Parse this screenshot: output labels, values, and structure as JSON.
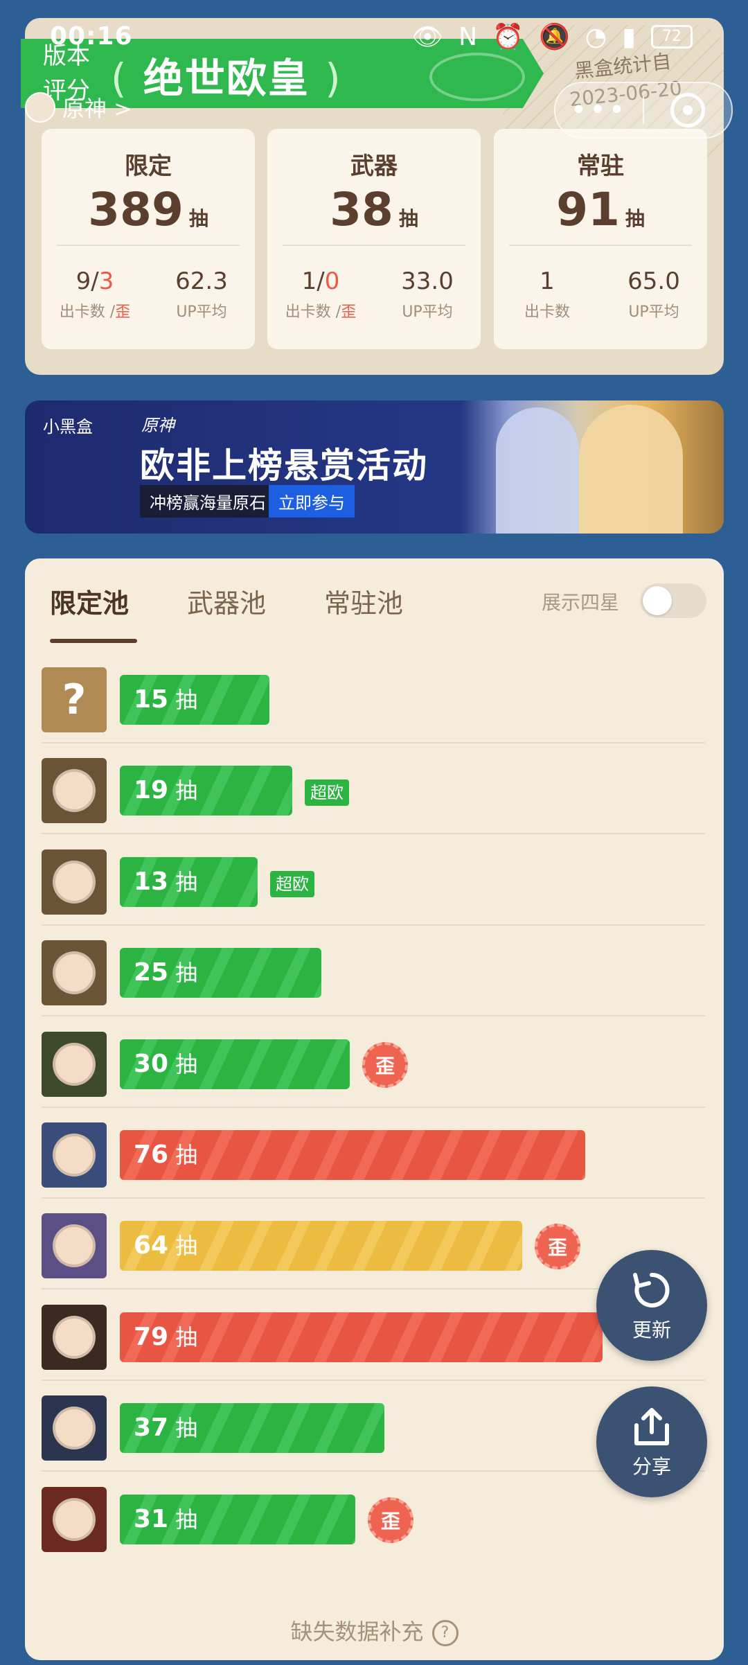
{
  "status_bar": {
    "time": "00:16",
    "battery": "72"
  },
  "header": {
    "banner_tag_line1": "版本",
    "banner_tag_line2": "评分",
    "banner_title": "绝世欧皇",
    "laurel_left": "(",
    "laurel_right": ")",
    "game_name": "原神 >",
    "stamp_line1": "黑盒统计自",
    "stamp_line2": "2023-06-20",
    "capsule_dots": "•••"
  },
  "stats": [
    {
      "title": "限定",
      "count": "389",
      "unit": "抽",
      "cards": "9/",
      "cards_off": "3",
      "avg": "62.3",
      "cards_label": "出卡数 /",
      "cards_label_off": "歪",
      "avg_label": "UP平均"
    },
    {
      "title": "武器",
      "count": "38",
      "unit": "抽",
      "cards": "1/",
      "cards_off": "0",
      "avg": "33.0",
      "cards_label": "出卡数 /",
      "cards_label_off": "歪",
      "avg_label": "UP平均"
    },
    {
      "title": "常驻",
      "count": "91",
      "unit": "抽",
      "cards": "1",
      "cards_off": "",
      "avg": "65.0",
      "cards_label": "出卡数",
      "cards_label_off": "",
      "avg_label": "UP平均"
    }
  ],
  "ad": {
    "logo": "小黑盒",
    "logo2": "原神",
    "title": "欧非上榜悬赏活动",
    "subtitle": "冲榜赢海量原石",
    "button": "立即参与"
  },
  "tabs": [
    "限定池",
    "武器池",
    "常驻池"
  ],
  "toggle_label": "展示四星",
  "rows": [
    {
      "count": "15",
      "unit": "抽",
      "color": "green",
      "fill": 0.26,
      "tag": "",
      "wai": "",
      "avatar": "#b08a55",
      "mystery": "?"
    },
    {
      "count": "19",
      "unit": "抽",
      "color": "green",
      "fill": 0.3,
      "tag": "超欧",
      "wai": "",
      "avatar": "#6b5335",
      "mystery": ""
    },
    {
      "count": "13",
      "unit": "抽",
      "color": "green",
      "fill": 0.24,
      "tag": "超欧",
      "wai": "",
      "avatar": "#6b5335",
      "mystery": ""
    },
    {
      "count": "25",
      "unit": "抽",
      "color": "green",
      "fill": 0.35,
      "tag": "",
      "wai": "",
      "avatar": "#6b5335",
      "mystery": ""
    },
    {
      "count": "30",
      "unit": "抽",
      "color": "green",
      "fill": 0.4,
      "tag": "",
      "wai": "歪",
      "avatar": "#3d4a2c",
      "mystery": ""
    },
    {
      "count": "76",
      "unit": "抽",
      "color": "red",
      "fill": 0.81,
      "tag": "",
      "wai": "",
      "avatar": "#3a4d7a",
      "mystery": ""
    },
    {
      "count": "64",
      "unit": "抽",
      "color": "yellow",
      "fill": 0.7,
      "tag": "",
      "wai": "歪",
      "avatar": "#5b4f86",
      "mystery": ""
    },
    {
      "count": "79",
      "unit": "抽",
      "color": "red",
      "fill": 0.84,
      "tag": "",
      "wai": "",
      "avatar": "#3b2a22",
      "mystery": ""
    },
    {
      "count": "37",
      "unit": "抽",
      "color": "green",
      "fill": 0.46,
      "tag": "",
      "wai": "",
      "avatar": "#2b3550",
      "mystery": ""
    },
    {
      "count": "31",
      "unit": "抽",
      "color": "green",
      "fill": 0.41,
      "tag": "",
      "wai": "歪",
      "avatar": "#6a2a22",
      "mystery": ""
    }
  ],
  "footer_link": "缺失数据补充",
  "fab_refresh": "更新",
  "fab_share": "分享"
}
